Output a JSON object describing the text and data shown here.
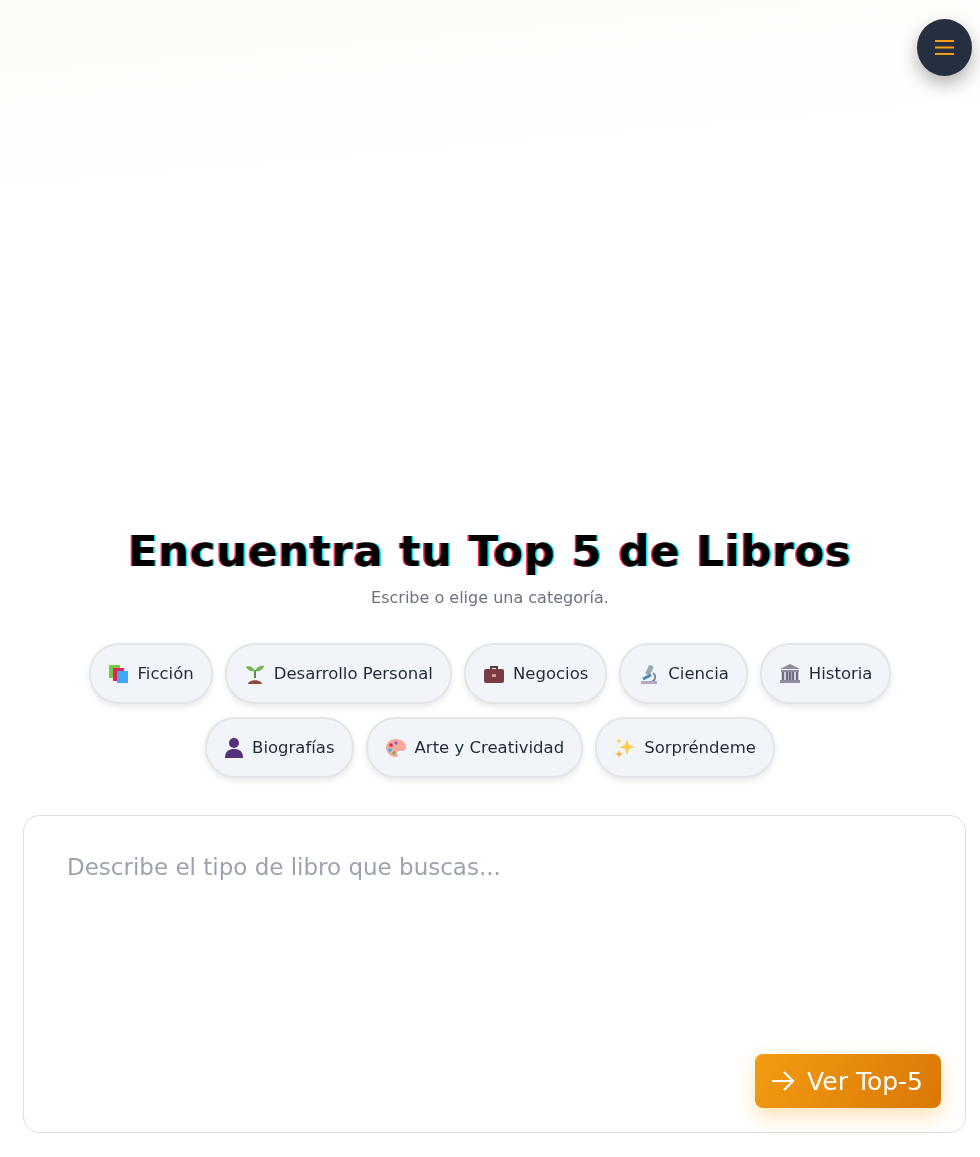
{
  "hero": {
    "title": "Encuentra tu Top 5 de Libros",
    "subtitle": "Escribe o elige una categoría."
  },
  "categories": [
    {
      "label": "Ficción"
    },
    {
      "label": "Desarrollo Personal"
    },
    {
      "label": "Negocios"
    },
    {
      "label": "Ciencia"
    },
    {
      "label": "Historia"
    },
    {
      "label": "Biografías"
    },
    {
      "label": "Arte y Creatividad"
    },
    {
      "label": "Sorpréndeme"
    }
  ],
  "search": {
    "placeholder": "Describe el tipo de libro que buscas...",
    "button": "Ver Top-5"
  }
}
